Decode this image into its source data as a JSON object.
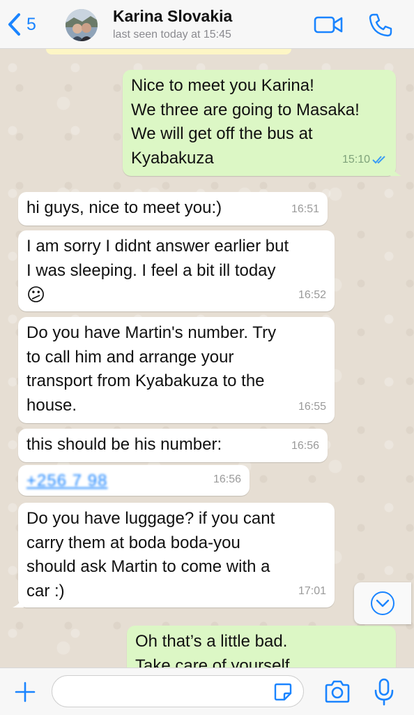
{
  "header": {
    "back_count": "5",
    "contact_name": "Karina Slovakia",
    "last_seen": "last seen today at 15:45",
    "icons": {
      "back": "chevron-left-icon",
      "video": "video-call-icon",
      "call": "phone-icon"
    }
  },
  "messages": [
    {
      "direction": "out",
      "text": "Nice to meet you Karina!\nWe three are going to Masaka!\nWe will get off the bus at\nKyabakuza",
      "time": "15:10",
      "status": "read"
    },
    {
      "direction": "in",
      "text": "hi guys, nice to meet you:)",
      "time": "16:51"
    },
    {
      "direction": "in",
      "text": "I am sorry I didnt answer earlier but\nI was sleeping. I feel a bit ill today",
      "emoji": "😕",
      "time": "16:52"
    },
    {
      "direction": "in",
      "text": "Do you have Martin's number. Try\nto call him and arrange your\ntransport from Kyabakuza to the\nhouse.",
      "time": "16:55"
    },
    {
      "direction": "in",
      "text": "this should be his number:",
      "time": "16:56"
    },
    {
      "direction": "in",
      "text": "+256 7    98",
      "time": "16:56",
      "link": true
    },
    {
      "direction": "in",
      "text": "Do you have luggage? if you cant\ncarry them at boda boda-you\nshould ask Martin to come with a\ncar :)",
      "time": "17:01"
    },
    {
      "direction": "out",
      "text": "Oh that’s a little bad.\nTake care of yourself",
      "time": "",
      "partial": true
    }
  ],
  "composer": {
    "placeholder": "",
    "icons": {
      "plus": "plus-icon",
      "sticker": "sticker-icon",
      "camera": "camera-icon",
      "mic": "microphone-icon"
    }
  },
  "colors": {
    "accent": "#1a84ff",
    "outgoing_bubble": "#dcf7c5",
    "incoming_bubble": "#ffffff",
    "chat_background": "#e6ded3"
  }
}
